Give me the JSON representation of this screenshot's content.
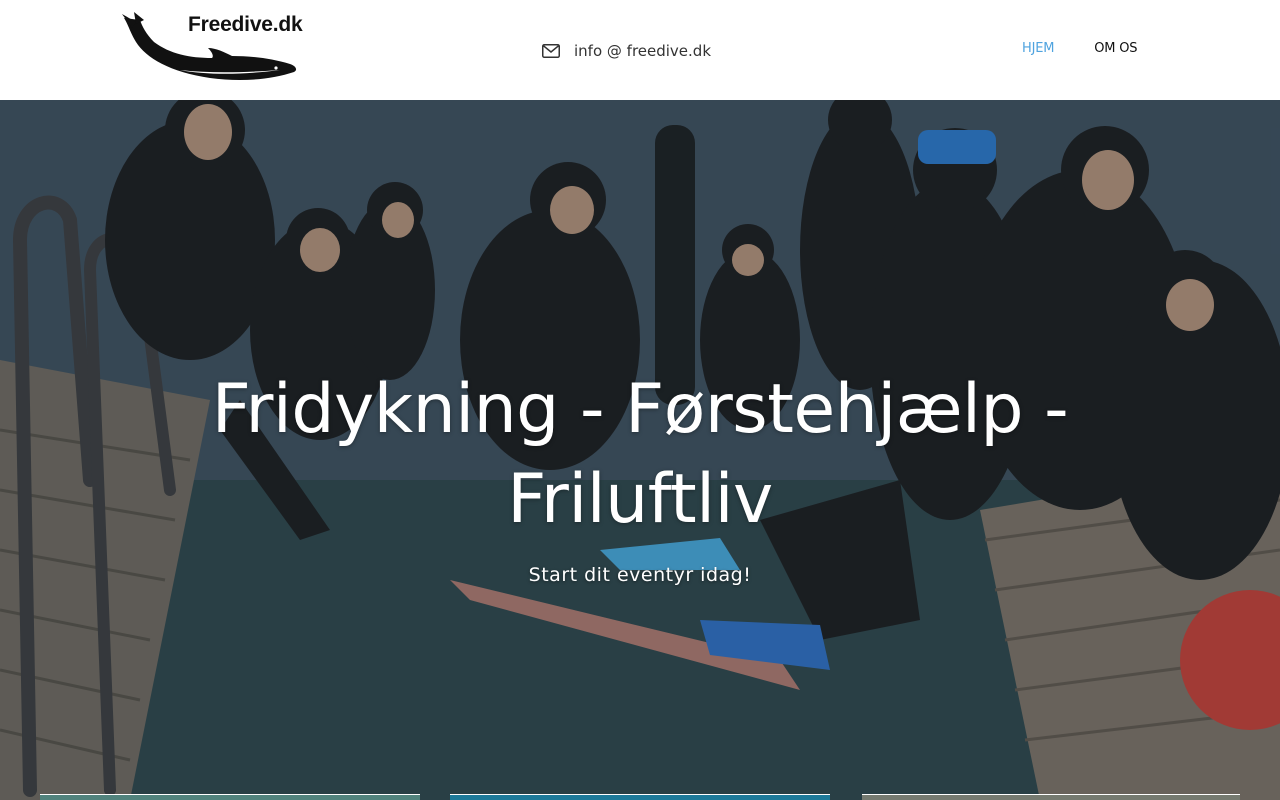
{
  "site": {
    "logo_text": "Freedive.dk",
    "logo_icon": "dolphin-logo"
  },
  "header": {
    "contact": {
      "icon": "mail-icon",
      "email": "info @ freedive.dk"
    },
    "nav": {
      "items": [
        {
          "label": "HJEM",
          "active": true
        },
        {
          "label": "OM OS",
          "active": false
        }
      ]
    }
  },
  "hero": {
    "title_line1": "Fridykning - Førstehjælp -",
    "title_line2": "Friluftliv",
    "subtitle": "Start dit eventyr idag!"
  },
  "colors": {
    "accent": "#4fa3df",
    "text_dark": "#111111",
    "hero_text": "#ffffff"
  }
}
